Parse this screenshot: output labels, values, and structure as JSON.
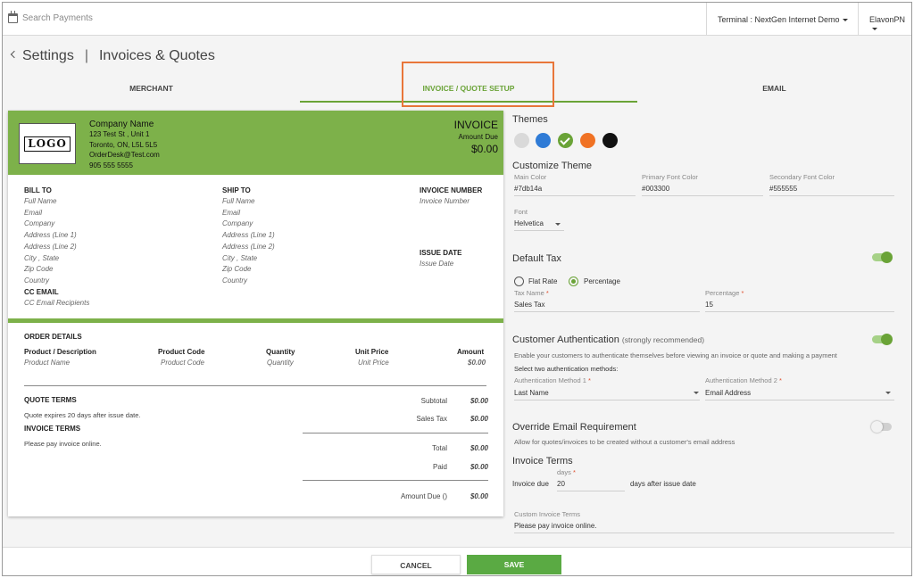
{
  "topbar": {
    "search_placeholder": "Search Payments",
    "terminal_label": "Terminal : NextGen Internet Demo",
    "account_label": "ElavonPN"
  },
  "header": {
    "back_label": "Settings",
    "separator": "|",
    "title": "Invoices & Quotes"
  },
  "tabs": [
    {
      "label": "MERCHANT",
      "active": false
    },
    {
      "label": "INVOICE / QUOTE SETUP",
      "active": true
    },
    {
      "label": "EMAIL",
      "active": false
    }
  ],
  "preview": {
    "logo_text": "LOGO",
    "company": {
      "name": "Company Name",
      "address1": "123 Test St , Unit 1",
      "address2": "Toronto, ON, L5L 5L5",
      "email": "OrderDesk@Test.com",
      "phone": "905 555 5555"
    },
    "invoice_title": "INVOICE",
    "amount_due_label": "Amount Due",
    "amount_due_value": "$0.00",
    "bill_to": {
      "label": "BILL TO",
      "lines": [
        "Full Name",
        "Email",
        "Company",
        "Address (Line 1)",
        "Address (Line 2)",
        "City , State",
        "Zip Code",
        "Country"
      ]
    },
    "ship_to": {
      "label": "SHIP TO",
      "lines": [
        "Full Name",
        "Email",
        "Company",
        "Address (Line 1)",
        "Address (Line 2)",
        "City , State",
        "Zip Code",
        "Country"
      ]
    },
    "invoice_number": {
      "label": "INVOICE NUMBER",
      "value": "Invoice Number"
    },
    "issue_date": {
      "label": "ISSUE DATE",
      "value": "Issue Date"
    },
    "cc_email": {
      "label": "CC EMAIL",
      "value": "CC Email Recipients"
    },
    "order_details": {
      "title": "ORDER DETAILS",
      "columns": [
        {
          "header": "Product / Description",
          "value": "Product Name"
        },
        {
          "header": "Product Code",
          "value": "Product Code"
        },
        {
          "header": "Quantity",
          "value": "Quantity"
        },
        {
          "header": "Unit Price",
          "value": "Unit Price"
        },
        {
          "header": "Amount",
          "value": "$0.00"
        }
      ]
    },
    "quote_terms": {
      "label": "QUOTE TERMS",
      "text": "Quote expires 20 days after issue date."
    },
    "invoice_terms": {
      "label": "INVOICE TERMS",
      "text": "Please pay invoice online."
    },
    "totals": [
      {
        "label": "Subtotal",
        "value": "$0.00"
      },
      {
        "label": "Sales Tax",
        "value": "$0.00"
      },
      {
        "label": "Total",
        "value": "$0.00"
      },
      {
        "label": "Paid",
        "value": "$0.00"
      },
      {
        "label": "Amount Due ()",
        "value": "$0.00"
      }
    ]
  },
  "themes": {
    "title": "Themes",
    "swatches": [
      {
        "color": "#d9d9d9",
        "selected": false
      },
      {
        "color": "#2f7bd6",
        "selected": false
      },
      {
        "color": "#6aa337",
        "selected": true
      },
      {
        "color": "#f07224",
        "selected": false
      },
      {
        "color": "#111111",
        "selected": false
      }
    ]
  },
  "customize_theme": {
    "title": "Customize Theme",
    "main_color": {
      "label": "Main Color",
      "value": "#7db14a"
    },
    "primary_font_color": {
      "label": "Primary Font Color",
      "value": "#003300"
    },
    "secondary_font_color": {
      "label": "Secondary Font Color",
      "value": "#555555"
    },
    "font": {
      "label": "Font",
      "value": "Helvetica"
    }
  },
  "default_tax": {
    "title": "Default Tax",
    "enabled": true,
    "flat_rate_label": "Flat Rate",
    "percentage_label": "Percentage",
    "tax_name_label": "Tax Name",
    "tax_name_value": "Sales Tax",
    "percentage_field_label": "Percentage",
    "percentage_value": "15",
    "required_mark": "*"
  },
  "customer_auth": {
    "title": "Customer Authentication",
    "note": "(strongly recommended)",
    "enabled": true,
    "description": "Enable your customers to authenticate themselves before viewing an invoice or quote and making a payment",
    "select_text": "Select two authentication methods:",
    "method1_label": "Authentication Method 1",
    "method1_value": "Last Name",
    "method2_label": "Authentication Method 2",
    "method2_value": "Email Address"
  },
  "override_email": {
    "title": "Override Email Requirement",
    "enabled": false,
    "description": "Allow for quotes/invoices to be created without a customer's email address"
  },
  "invoice_terms_setting": {
    "title": "Invoice Terms",
    "days_label": "days",
    "prefix": "Invoice due",
    "days_value": "20",
    "suffix": "days after issue date",
    "custom_label": "Custom Invoice Terms",
    "custom_value": "Please pay invoice online."
  },
  "footer": {
    "cancel_label": "CANCEL",
    "save_label": "SAVE"
  }
}
